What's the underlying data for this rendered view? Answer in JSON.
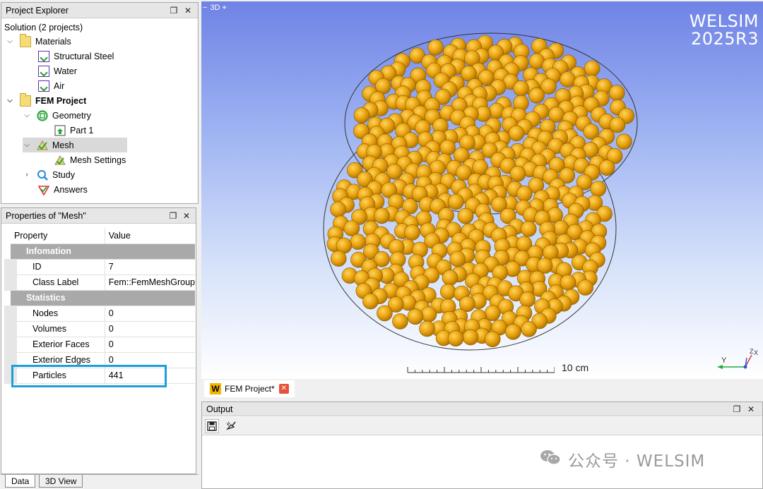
{
  "project_explorer": {
    "title": "Project Explorer",
    "root": "Solution (2 projects)",
    "items": [
      {
        "label": "Materials"
      },
      {
        "label": "Structural Steel"
      },
      {
        "label": "Water"
      },
      {
        "label": "Air"
      },
      {
        "label": "FEM Project"
      },
      {
        "label": "Geometry"
      },
      {
        "label": "Part 1"
      },
      {
        "label": "Mesh"
      },
      {
        "label": "Mesh Settings"
      },
      {
        "label": "Study"
      },
      {
        "label": "Answers"
      }
    ]
  },
  "properties": {
    "title": "Properties of \"Mesh\"",
    "header_property": "Property",
    "header_value": "Value",
    "group_info": "Infomation",
    "id_label": "ID",
    "id_value": "7",
    "class_label": "Class Label",
    "class_value": "Fem::FemMeshGroup",
    "group_stats": "Statistics",
    "nodes_label": "Nodes",
    "nodes_value": "0",
    "volumes_label": "Volumes",
    "volumes_value": "0",
    "ext_faces_label": "Exterior Faces",
    "ext_faces_value": "0",
    "ext_edges_label": "Exterior Edges",
    "ext_edges_value": "0",
    "particles_label": "Particles",
    "particles_value": "441",
    "highlight_color": "#1a9fd8"
  },
  "bottom_tabs": {
    "data": "Data",
    "view3d": "3D View"
  },
  "viewer": {
    "tab_label": "3D",
    "watermark_line1": "WELSIM",
    "watermark_line2": "2025R3",
    "scale_label": "10 cm",
    "axis_y": "Y",
    "axis_z": "Z",
    "axis_x": "X",
    "particle_color": "#e8a10e",
    "background_top": "#6f83e6"
  },
  "document_tab": {
    "label": "FEM Project*"
  },
  "output": {
    "title": "Output"
  },
  "footer_watermark": "公众号 · WELSIM"
}
